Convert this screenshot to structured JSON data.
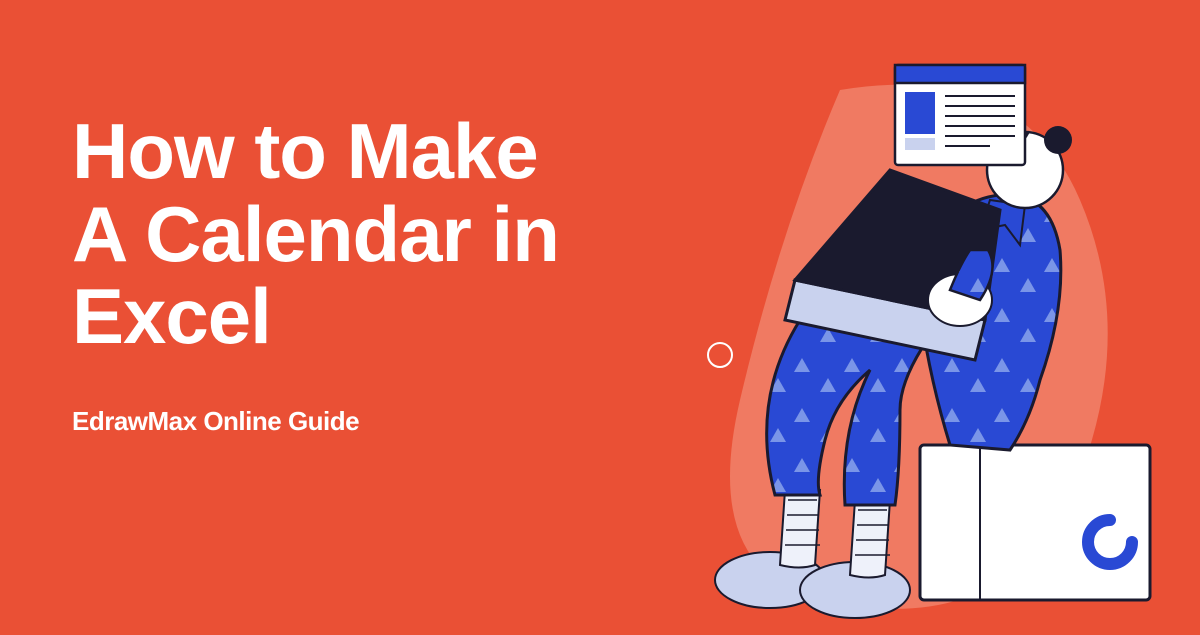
{
  "headline_line1": "How to Make",
  "headline_line2": "A Calendar in",
  "headline_line3": "Excel",
  "subhead": "EdrawMax Online Guide",
  "colors": {
    "background": "#ea5035",
    "text": "#ffffff",
    "blue": "#2949d4",
    "darkNavy": "#1a1a2e",
    "paleBlue": "#c9d2ee",
    "lightPeach": "#f07a62"
  }
}
